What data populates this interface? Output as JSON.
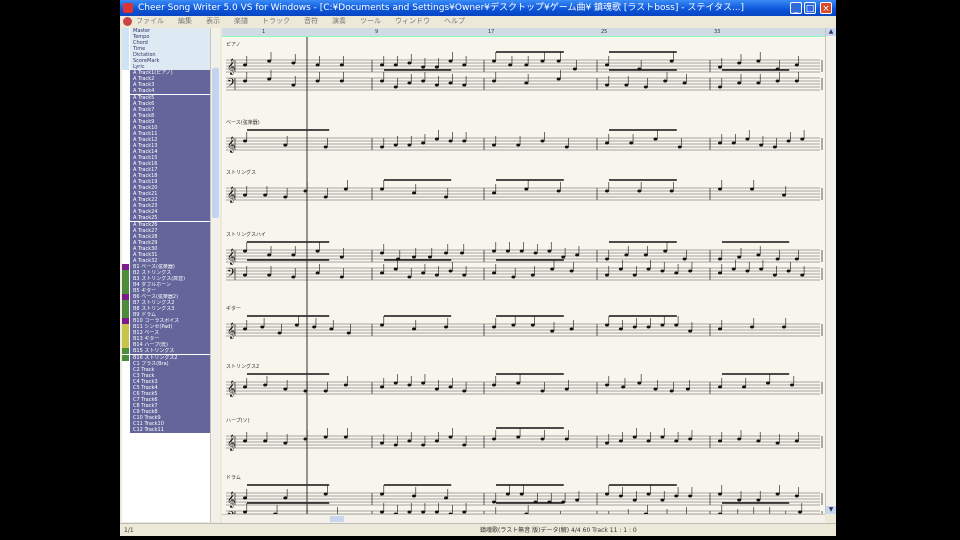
{
  "window": {
    "title": "Cheer Song Writer 5.0 VS for Windows - [C:¥Documents and Settings¥Owner¥デスクトップ¥ゲーム曲¥ 鎮魂歌 [ラストboss] - ステイタス...]",
    "minimize": "_",
    "maximize": "□",
    "close": "×"
  },
  "menu": [
    "ファイル",
    "編集",
    "表示",
    "楽譜",
    "トラック",
    "音符",
    "演奏",
    "ツール",
    "ウィンドウ",
    "ヘルプ"
  ],
  "colors": {
    "track_bg": "#64659a",
    "system_bg": "#dde9f3",
    "titlebar": "#0a53d8",
    "score_bg": "#f7f5ec"
  },
  "system_tracks": [
    "Master",
    "Tempo",
    "Chord",
    "Time",
    "Dictation",
    "ScoreMark",
    "Lyric"
  ],
  "tracks": [
    {
      "name": "A Track1(ピアノ)",
      "mark": ""
    },
    {
      "name": "A Track2",
      "mark": ""
    },
    {
      "name": "A Track3",
      "mark": ""
    },
    {
      "name": "A Track4",
      "mark": ""
    },
    {
      "name": "A Track5",
      "mark": ""
    },
    {
      "name": "A Track6",
      "mark": ""
    },
    {
      "name": "A Track7",
      "mark": ""
    },
    {
      "name": "A Track8",
      "mark": ""
    },
    {
      "name": "A Track9",
      "mark": ""
    },
    {
      "name": "A Track10",
      "mark": ""
    },
    {
      "name": "A Track11",
      "mark": ""
    },
    {
      "name": "A Track12",
      "mark": ""
    },
    {
      "name": "A Track13",
      "mark": ""
    },
    {
      "name": "A Track14",
      "mark": ""
    },
    {
      "name": "A Track15",
      "mark": ""
    },
    {
      "name": "A Track16",
      "mark": ""
    },
    {
      "name": "A Track17",
      "mark": ""
    },
    {
      "name": "A Track18",
      "mark": ""
    },
    {
      "name": "A Track19",
      "mark": ""
    },
    {
      "name": "A Track20",
      "mark": ""
    },
    {
      "name": "A Track21",
      "mark": ""
    },
    {
      "name": "A Track22",
      "mark": ""
    },
    {
      "name": "A Track23",
      "mark": ""
    },
    {
      "name": "A Track24",
      "mark": ""
    },
    {
      "name": "A Track25",
      "mark": ""
    },
    {
      "name": "A Track26",
      "mark": ""
    },
    {
      "name": "A Track27",
      "mark": ""
    },
    {
      "name": "A Track28",
      "mark": ""
    },
    {
      "name": "A Track29",
      "mark": ""
    },
    {
      "name": "A Track30",
      "mark": ""
    },
    {
      "name": "A Track31",
      "mark": ""
    },
    {
      "name": "A Track32",
      "mark": ""
    },
    {
      "name": "B1 ベース(弦楽器)",
      "mark": "purple"
    },
    {
      "name": "B2 ストリングス",
      "mark": "green"
    },
    {
      "name": "B3 ストリングス(高音)",
      "mark": "green"
    },
    {
      "name": "B4 ダブルホーン",
      "mark": "green"
    },
    {
      "name": "B5 ギター",
      "mark": "green"
    },
    {
      "name": "B6 ベース(弦楽器2)",
      "mark": "purple"
    },
    {
      "name": "B7 ストリングス2",
      "mark": "green"
    },
    {
      "name": "B8 ストリングス3",
      "mark": "green"
    },
    {
      "name": "B9 ドラム",
      "mark": "green"
    },
    {
      "name": "B10 コーラスボイス",
      "mark": "purple"
    },
    {
      "name": "B11 シンセ(Pad)",
      "mark": "yellow"
    },
    {
      "name": "B12 ベース",
      "mark": "yellow"
    },
    {
      "name": "B13 ギター",
      "mark": "yellow"
    },
    {
      "name": "B14 ハープ(低)",
      "mark": "yellow"
    },
    {
      "name": "B15 ストリングス",
      "mark": "green"
    },
    {
      "name": "B16 ストリングス2",
      "mark": "green"
    },
    {
      "name": "C1 ブラス(Bra)",
      "mark": ""
    },
    {
      "name": "C2 Track",
      "mark": ""
    },
    {
      "name": "C3 Track",
      "mark": ""
    },
    {
      "name": "C4 Track3",
      "mark": ""
    },
    {
      "name": "C5 Track4",
      "mark": ""
    },
    {
      "name": "C6 Track5",
      "mark": ""
    },
    {
      "name": "C7 Track6",
      "mark": ""
    },
    {
      "name": "C8 Track7",
      "mark": ""
    },
    {
      "name": "C9 Track8",
      "mark": ""
    },
    {
      "name": "C10 Track9",
      "mark": ""
    },
    {
      "name": "C11 Track10",
      "mark": ""
    },
    {
      "name": "C12 Track11",
      "mark": ""
    }
  ],
  "ruler": [
    "1",
    "9",
    "17",
    "25",
    "33"
  ],
  "staves": [
    {
      "name": "ピアノ",
      "grand": true
    },
    {
      "name": "ベース(弦楽器)",
      "grand": false
    },
    {
      "name": "ストリングス",
      "grand": false
    },
    {
      "name": "ストリングスハイ",
      "grand": true
    },
    {
      "name": "ギター",
      "grand": false
    },
    {
      "name": "ストリングス2",
      "grand": false
    },
    {
      "name": "ハープ(ソ)",
      "grand": false
    },
    {
      "name": "ドラム",
      "grand": true
    }
  ],
  "statusbar": {
    "text": "鎮魂歌(ラスト無音 版)データ(解) 4/4 60 Track 11 : 1 : 0",
    "counter": "1/1"
  }
}
